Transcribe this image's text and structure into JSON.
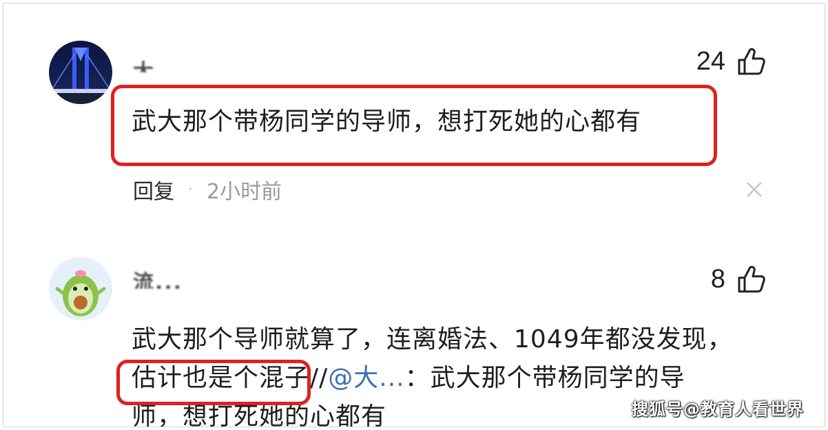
{
  "comments": [
    {
      "username": "大...",
      "likes": "24",
      "text": "武大那个带杨同学的导师，想打死她的心都有",
      "reply_label": "回复",
      "separator": "·",
      "time": "2小时前"
    },
    {
      "username": "流...",
      "likes": "8",
      "text_line1": "武大那个导师就算了，连离婚法、1049年都没发现，",
      "text_line2_start": "估计也是个混子//",
      "mention": "@大...",
      "text_line2_end": "：武大那个带杨同学的导",
      "text_line3": "师，想打死她的心都有"
    }
  ],
  "watermark": "搜狐号@教育人看世界",
  "colors": {
    "highlight": "#e02020",
    "mention": "#3b6fb6",
    "meta": "#9a9a9a"
  },
  "icons": [
    "thumbs-up-icon",
    "close-icon"
  ]
}
